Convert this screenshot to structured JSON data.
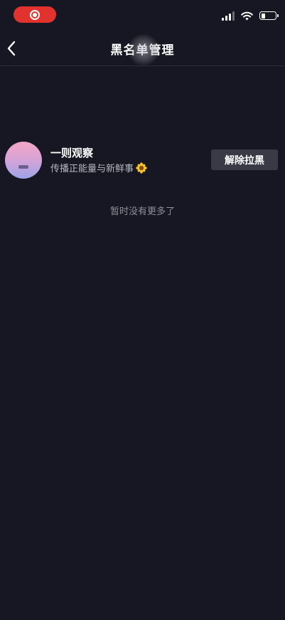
{
  "status_bar": {
    "recording_icon": "record-icon",
    "signal_icon": "cellular-signal-icon",
    "wifi_icon": "wifi-icon",
    "battery_icon": "battery-icon",
    "battery_level": 0.25
  },
  "nav": {
    "back_icon": "chevron-left-icon",
    "title": "黑名单管理"
  },
  "blocked_users": [
    {
      "name": "一则观察",
      "bio": "传播正能量与新鲜事",
      "bio_emoji": "sunflower-icon",
      "action_label": "解除拉黑"
    }
  ],
  "footer_text": "暂时没有更多了",
  "colors": {
    "background": "#161722",
    "recording": "#e2322e",
    "button_bg": "#393a45",
    "secondary_text": "#b5b6bf",
    "muted_text": "#8e8f99"
  }
}
